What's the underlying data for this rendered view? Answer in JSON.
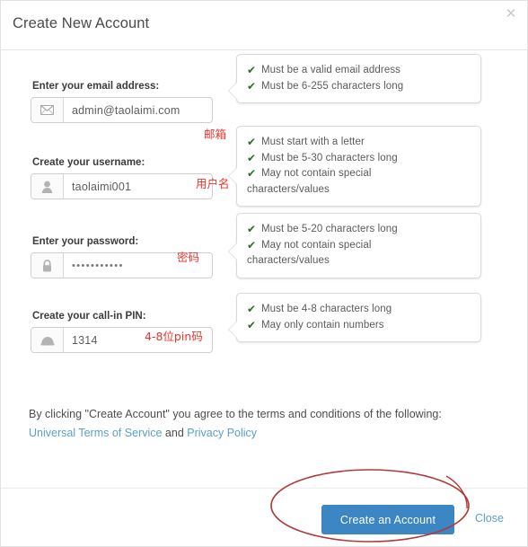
{
  "dialog": {
    "title": "Create New Account",
    "close_icon": "close-icon"
  },
  "fields": [
    {
      "label": "Enter your email address:",
      "icon": "envelope-icon",
      "value": "admin@taolaimi.com",
      "annotation": "邮箱",
      "rules": [
        "Must be a valid email address",
        "Must be 6-255 characters long"
      ]
    },
    {
      "label": "Create your username:",
      "icon": "user-icon",
      "value": "taolaimi001",
      "annotation": "用户名",
      "rules": [
        "Must start with a letter",
        "Must be 5-30 characters long",
        "May not contain special"
      ],
      "rules_cont": "characters/values"
    },
    {
      "label": "Enter your password:",
      "icon": "lock-icon",
      "value": "•••••••••••",
      "annotation": "密码",
      "rules": [
        "Must be 5-20 characters long",
        "May not contain special"
      ],
      "rules_cont": "characters/values"
    },
    {
      "label": "Create your call-in PIN:",
      "icon": "telephone-icon",
      "value": "1314",
      "annotation": "4-8位pin码",
      "rules": [
        "Must be 4-8 characters long",
        "May only contain numbers"
      ]
    }
  ],
  "terms": {
    "text_before": "By clicking \"Create Account\" you agree to the terms and conditions of the following:",
    "link_tos": "Universal Terms of Service",
    "conjunction": "and",
    "link_privacy": "Privacy Policy"
  },
  "footer": {
    "primary_label": "Create an Account",
    "close_label": "Close"
  },
  "check_glyph": "✔",
  "colors": {
    "accent_button": "#3b86c3",
    "link": "#5ba0c8",
    "annotation_red": "#e8352c",
    "check_green": "#2f6b2f"
  }
}
